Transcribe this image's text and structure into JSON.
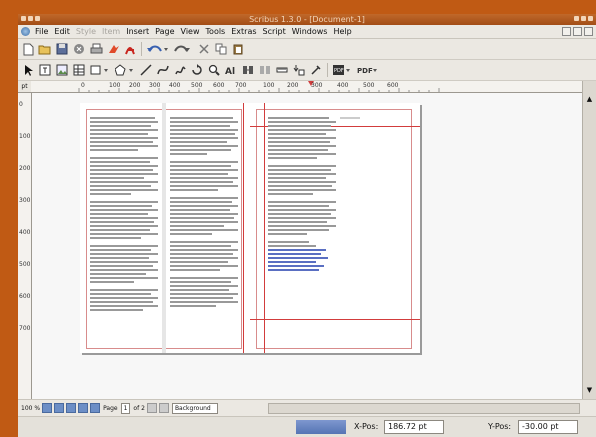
{
  "window": {
    "title": "Scribus 1.3.0 - [Document-1]"
  },
  "menubar": {
    "items": [
      {
        "label": "File",
        "enabled": true
      },
      {
        "label": "Edit",
        "enabled": true
      },
      {
        "label": "Style",
        "enabled": false
      },
      {
        "label": "Item",
        "enabled": false
      },
      {
        "label": "Insert",
        "enabled": true
      },
      {
        "label": "Page",
        "enabled": true
      },
      {
        "label": "View",
        "enabled": true
      },
      {
        "label": "Tools",
        "enabled": true
      },
      {
        "label": "Extras",
        "enabled": true
      },
      {
        "label": "Script",
        "enabled": true
      },
      {
        "label": "Windows",
        "enabled": true
      },
      {
        "label": "Help",
        "enabled": true
      }
    ]
  },
  "toolbar": {
    "main_icons": [
      "new-document-icon",
      "open-icon",
      "save-icon",
      "close-icon",
      "print-icon",
      "preflight-icon",
      "pdf-export-icon",
      "undo-icon",
      "redo-icon",
      "cut-icon",
      "copy-icon",
      "paste-icon"
    ],
    "tool_icons": [
      "select-icon",
      "text-frame-icon",
      "image-frame-icon",
      "table-icon",
      "shape-icon",
      "polygon-icon",
      "line-icon",
      "bezier-icon",
      "freehand-icon",
      "rotate-icon",
      "zoom-icon",
      "edit-text-icon",
      "link-icon",
      "unlink-icon",
      "measure-icon",
      "copy-properties-icon",
      "eyedropper-icon"
    ],
    "pdf_tools_label": "PDF",
    "pdf_annot_label": "PDF"
  },
  "ruler": {
    "unit": "pt",
    "h_labels": [
      "0",
      "100",
      "200",
      "300",
      "400",
      "500",
      "600",
      "700",
      "100",
      "200",
      "300",
      "400",
      "500",
      "600"
    ],
    "v_labels": [
      "0",
      "100",
      "200",
      "300",
      "400",
      "500",
      "600",
      "700"
    ]
  },
  "bottombar": {
    "zoom": "100 %",
    "page_label": "Page",
    "page_value": "1",
    "of_label": "of 2",
    "layer": "Background"
  },
  "status": {
    "xpos_label": "X-Pos:",
    "xpos_value": "186.72 pt",
    "ypos_label": "Y-Pos:",
    "ypos_value": "-30.00 pt"
  }
}
